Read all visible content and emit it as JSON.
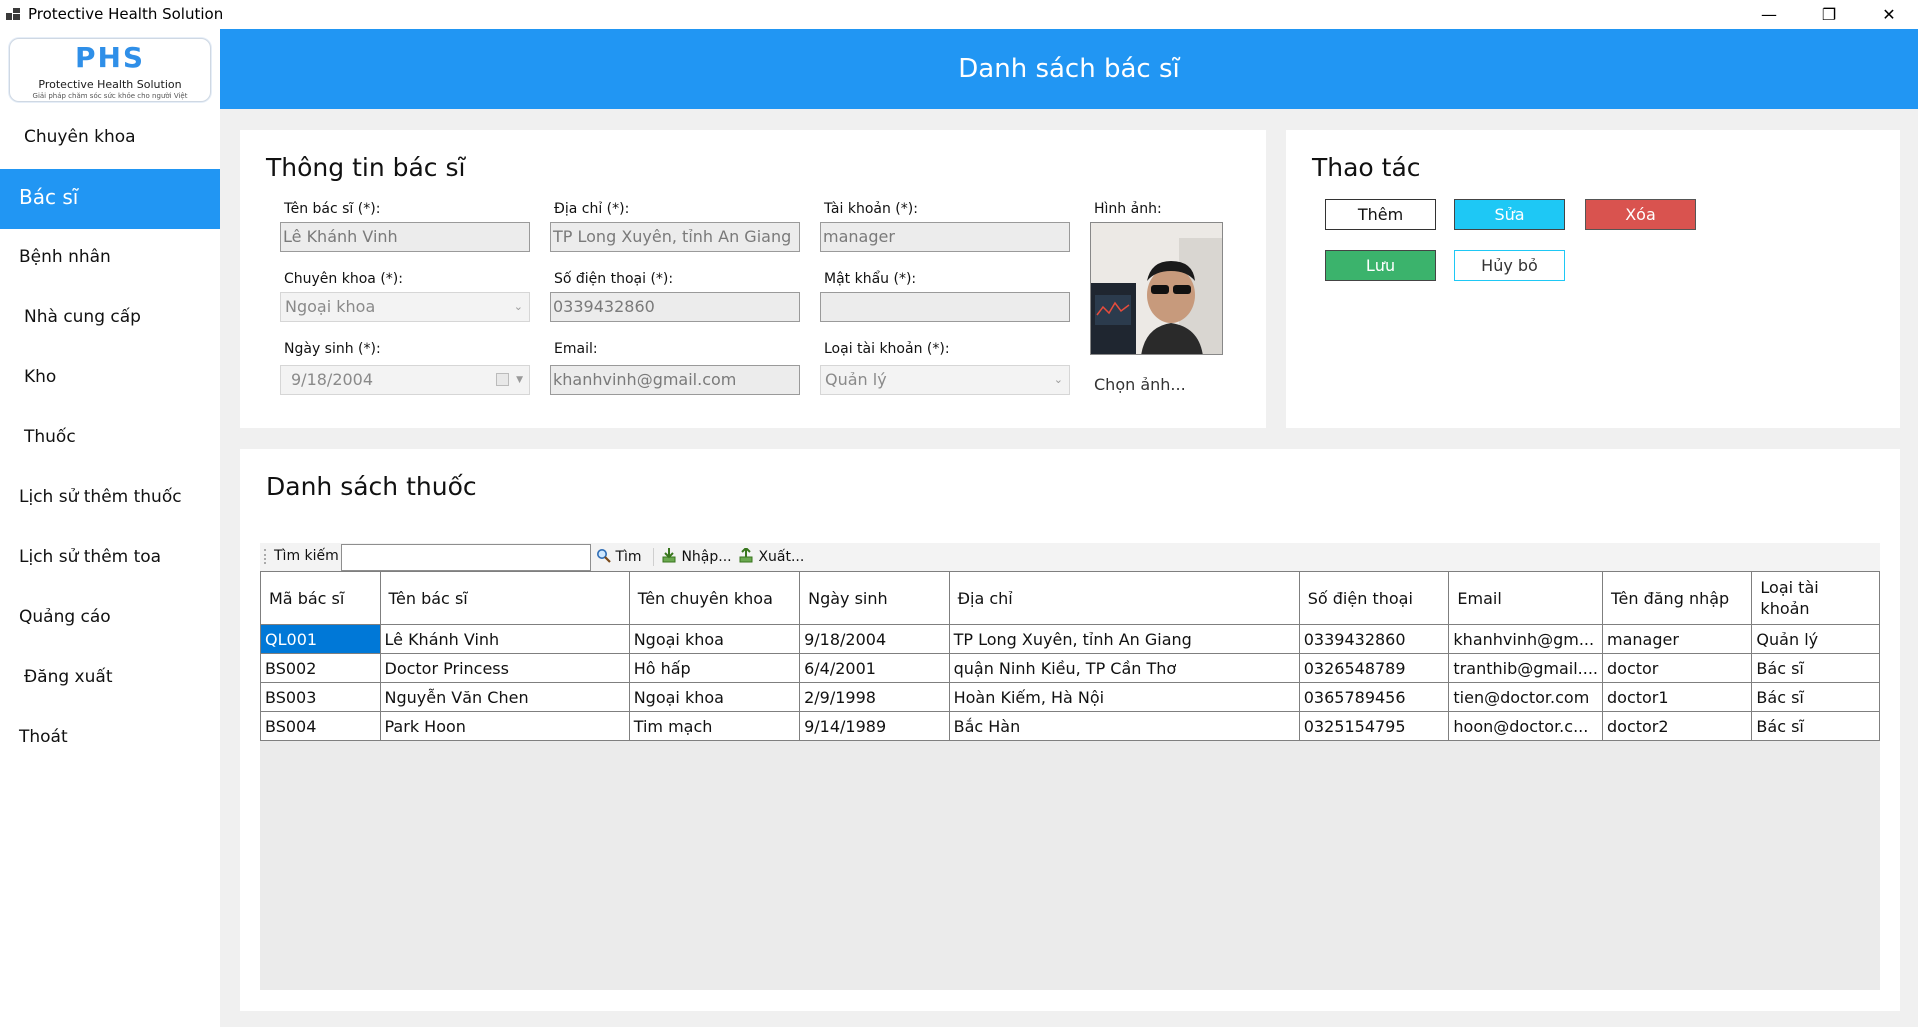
{
  "window": {
    "title": "Protective Health Solution",
    "minimize": "—",
    "maximize": "❐",
    "close": "✕"
  },
  "logo": {
    "mark": "PHS",
    "name": "Protective Health Solution",
    "tagline": "Giải pháp chăm sóc sức khỏe cho người Việt"
  },
  "header": {
    "title": "Danh sách bác sĩ"
  },
  "sidebar": {
    "items": [
      {
        "label": "Chuyên khoa",
        "active": false
      },
      {
        "label": "Bác sĩ",
        "active": true
      },
      {
        "label": "Bệnh nhân",
        "active": false
      },
      {
        "label": "Nhà cung cấp",
        "active": false
      },
      {
        "label": "Kho",
        "active": false
      },
      {
        "label": "Thuốc",
        "active": false
      },
      {
        "label": "Lịch sử thêm thuốc",
        "active": false
      },
      {
        "label": "Lịch sử thêm toa",
        "active": false
      },
      {
        "label": "Quảng cáo",
        "active": false
      },
      {
        "label": "Đăng xuất",
        "active": false
      },
      {
        "label": "Thoát",
        "active": false
      }
    ]
  },
  "info": {
    "title": "Thông tin bác sĩ",
    "name_label": "Tên bác sĩ (*):",
    "name_value": "Lê Khánh Vinh",
    "address_label": "Địa chỉ (*):",
    "address_value": "TP Long Xuyên, tỉnh An Giang",
    "account_label": "Tài khoản (*):",
    "account_value": "manager",
    "photo_label": "Hình ảnh:",
    "specialty_label": "Chuyên khoa (*):",
    "specialty_value": "Ngoại khoa",
    "phone_label": "Số điện thoại (*):",
    "phone_value": "0339432860",
    "password_label": "Mật khẩu (*):",
    "password_value": "",
    "dob_label": "Ngày sinh (*):",
    "dob_value": "9/18/2004",
    "email_label": "Email:",
    "email_value": "khanhvinh@gmail.com",
    "account_type_label": "Loại tài khoản (*):",
    "account_type_value": "Quản lý",
    "choose_photo": "Chọn ảnh..."
  },
  "actions": {
    "title": "Thao tác",
    "add": "Thêm",
    "edit": "Sửa",
    "delete": "Xóa",
    "save": "Lưu",
    "cancel": "Hủy bỏ"
  },
  "list": {
    "title": "Danh sách thuốc",
    "search_label": "Tìm kiếm",
    "search_value": "",
    "find": "Tìm",
    "import": "Nhập...",
    "export": "Xuất...",
    "columns": [
      "Mã bác sĩ",
      "Tên bác sĩ",
      "Tên chuyên khoa",
      "Ngày sinh",
      "Địa chỉ",
      "Số điện thoại",
      "Email",
      "Tên đăng nhập",
      "Loại tài khoản"
    ],
    "rows": [
      [
        "QL001",
        "Lê Khánh Vinh",
        "Ngoại khoa",
        "9/18/2004",
        "TP Long Xuyên, tỉnh An Giang",
        "0339432860",
        "khanhvinh@gm...",
        "manager",
        "Quản lý"
      ],
      [
        "BS002",
        "Doctor Princess",
        "Hô hấp",
        "6/4/2001",
        "quận Ninh Kiều, TP Cần Thơ",
        "0326548789",
        "tranthib@gmail....",
        "doctor",
        "Bác sĩ"
      ],
      [
        "BS003",
        "Nguyễn Văn Chen",
        "Ngoại khoa",
        "2/9/1998",
        "Hoàn Kiếm, Hà Nội",
        "0365789456",
        "tien@doctor.com",
        "doctor1",
        "Bác sĩ"
      ],
      [
        "BS004",
        "Park Hoon",
        "Tim mạch",
        "9/14/1989",
        "Bắc Hàn",
        "0325154795",
        "hoon@doctor.c...",
        "doctor2",
        "Bác sĩ"
      ]
    ]
  },
  "colors": {
    "accent": "#2196f3",
    "edit_button": "#1ec8f5",
    "delete_button": "#d9534f",
    "save_button": "#3bb36c",
    "selection": "#0078d7"
  }
}
